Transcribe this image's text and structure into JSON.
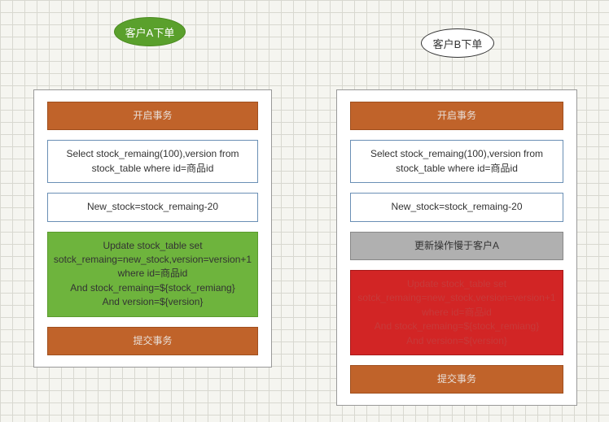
{
  "customerA": {
    "title": "客户A下单",
    "steps": {
      "begin": "开启事务",
      "select": "Select stock_remaing(100),version from stock_table where id=商品id",
      "calc": "New_stock=stock_remaing-20",
      "update": "Update stock_table set sotck_remaing=new_stock,version=version+1 where id=商品id\nAnd stock_remaing=${stock_remiang}\nAnd version=${version}",
      "commit": "提交事务"
    }
  },
  "customerB": {
    "title": "客户B下单",
    "steps": {
      "begin": "开启事务",
      "select": "Select stock_remaing(100),version from stock_table where id=商品id",
      "calc": "New_stock=stock_remaing-20",
      "wait": "更新操作慢于客户A",
      "update": "Update stock_table set sotck_remaing=new_stock,version=version+1 where id=商品id\nAnd stock_remaing=${stock_remiang}\nAnd version=${version}",
      "commit": "提交事务"
    }
  },
  "watermark": ""
}
